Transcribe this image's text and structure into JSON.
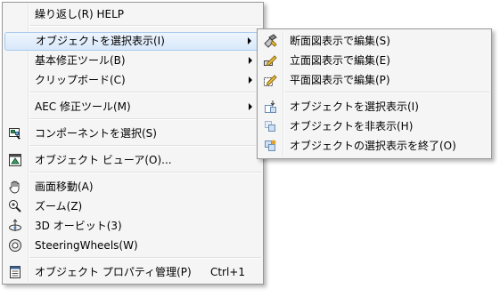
{
  "main_menu": {
    "items": [
      {
        "label": "繰り返し(R) HELP"
      },
      {
        "label": "オブジェクトを選択表示(I)"
      },
      {
        "label": "基本修正ツール(B)"
      },
      {
        "label": "クリップボード(C)"
      },
      {
        "label": "AEC 修正ツール(M)"
      },
      {
        "label": "コンポーネントを選択(S)"
      },
      {
        "label": "オブジェクト ビューア(O)..."
      },
      {
        "label": "画面移動(A)"
      },
      {
        "label": "ズーム(Z)"
      },
      {
        "label": "3D オービット(3)"
      },
      {
        "label": "SteeringWheels(W)"
      },
      {
        "label": "オブジェクト プロパティ管理(P)",
        "shortcut": "Ctrl+1"
      }
    ]
  },
  "submenu": {
    "items": [
      {
        "label": "断面図表示で編集(S)"
      },
      {
        "label": "立面図表示で編集(E)"
      },
      {
        "label": "平面図表示で編集(P)"
      },
      {
        "label": "オブジェクトを選択表示(I)"
      },
      {
        "label": "オブジェクトを非表示(H)"
      },
      {
        "label": "オブジェクトの選択表示を終了(O)"
      }
    ]
  },
  "icons": {
    "component_select": "component-select-icon",
    "object_viewer": "object-viewer-icon",
    "pan": "hand-pan-icon",
    "zoom": "zoom-magnifier-icon",
    "orbit": "orbit-icon",
    "steering_wheels": "steering-wheel-icon",
    "properties": "properties-palette-icon",
    "section_edit": "section-edit-icon",
    "elevation_edit": "elevation-edit-icon",
    "plan_edit": "plan-edit-icon",
    "isolate_objects": "isolate-objects-icon",
    "hide_objects": "hide-objects-icon",
    "end_isolation": "end-isolation-icon"
  },
  "colors": {
    "menu_bg": "#f5f5f5",
    "highlight_border": "#a8c9ee",
    "highlight_bg": "#d8e8fa"
  }
}
